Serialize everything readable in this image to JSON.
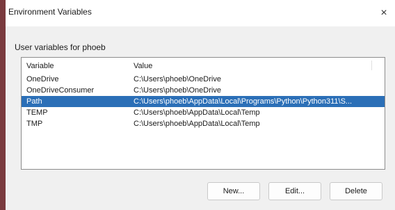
{
  "window": {
    "title": "Environment Variables",
    "close_glyph": "×"
  },
  "section_label": "User variables for phoeb",
  "table": {
    "columns": [
      "Variable",
      "Value"
    ],
    "rows": [
      {
        "variable": "OneDrive",
        "value": "C:\\Users\\phoeb\\OneDrive",
        "selected": false
      },
      {
        "variable": "OneDriveConsumer",
        "value": "C:\\Users\\phoeb\\OneDrive",
        "selected": false
      },
      {
        "variable": "Path",
        "value": "C:\\Users\\phoeb\\AppData\\Local\\Programs\\Python\\Python311\\S...",
        "selected": true
      },
      {
        "variable": "TEMP",
        "value": "C:\\Users\\phoeb\\AppData\\Local\\Temp",
        "selected": false
      },
      {
        "variable": "TMP",
        "value": "C:\\Users\\phoeb\\AppData\\Local\\Temp",
        "selected": false
      }
    ]
  },
  "buttons": {
    "new_label": "New...",
    "edit_label": "Edit...",
    "delete_label": "Delete"
  },
  "colors": {
    "selection": "#2b6fb7",
    "dialog_bg": "#f0f0f0",
    "accent_edge": "#7a3a3e"
  }
}
